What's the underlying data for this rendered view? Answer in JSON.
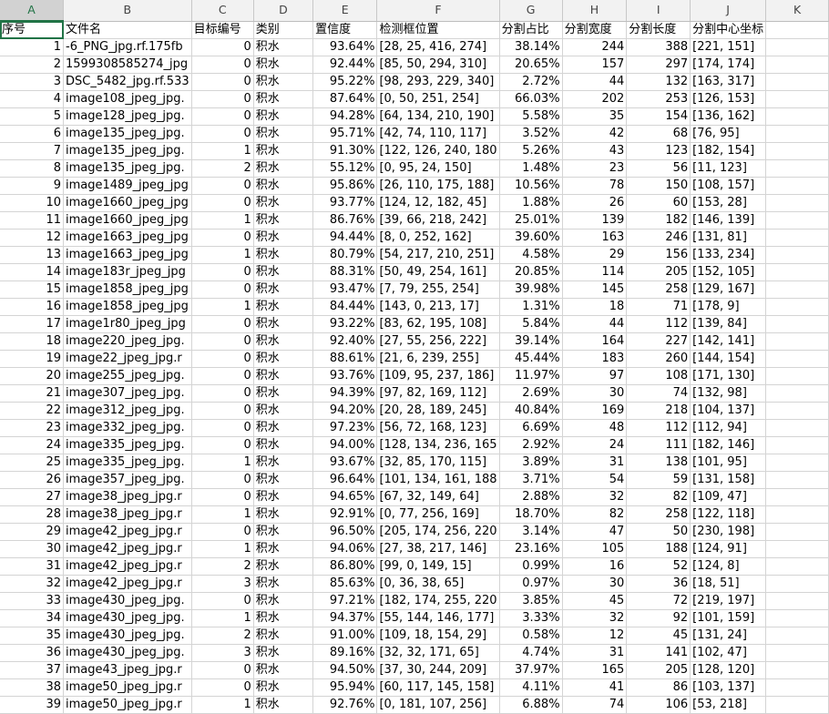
{
  "column_letters": [
    "A",
    "B",
    "C",
    "D",
    "E",
    "F",
    "G",
    "H",
    "I",
    "J",
    "K"
  ],
  "headers": [
    "序号",
    "文件名",
    "目标编号",
    "类别",
    "置信度",
    "检测框位置",
    "分割占比",
    "分割宽度",
    "分割长度",
    "分割中心坐标",
    ""
  ],
  "rows": [
    [
      "1",
      "-6_PNG_jpg.rf.175fb",
      "0",
      "积水",
      "93.64%",
      "[28, 25, 416, 274]",
      "38.14%",
      "244",
      "388",
      "[221, 151]"
    ],
    [
      "2",
      "1599308585274_jpg",
      "0",
      "积水",
      "92.44%",
      "[85, 50, 294, 310]",
      "20.65%",
      "157",
      "297",
      "[174, 174]"
    ],
    [
      "3",
      "DSC_5482_jpg.rf.533",
      "0",
      "积水",
      "95.22%",
      "[98, 293, 229, 340]",
      "2.72%",
      "44",
      "132",
      "[163, 317]"
    ],
    [
      "4",
      "image108_jpeg_jpg.",
      "0",
      "积水",
      "87.64%",
      "[0, 50, 251, 254]",
      "66.03%",
      "202",
      "253",
      "[126, 153]"
    ],
    [
      "5",
      "image128_jpeg_jpg.",
      "0",
      "积水",
      "94.28%",
      "[64, 134, 210, 190]",
      "5.58%",
      "35",
      "154",
      "[136, 162]"
    ],
    [
      "6",
      "image135_jpeg_jpg.",
      "0",
      "积水",
      "95.71%",
      "[42, 74, 110, 117]",
      "3.52%",
      "42",
      "68",
      "[76, 95]"
    ],
    [
      "7",
      "image135_jpeg_jpg.",
      "1",
      "积水",
      "91.30%",
      "[122, 126, 240, 180",
      "5.26%",
      "43",
      "123",
      "[182, 154]"
    ],
    [
      "8",
      "image135_jpeg_jpg.",
      "2",
      "积水",
      "55.12%",
      "[0, 95, 24, 150]",
      "1.48%",
      "23",
      "56",
      "[11, 123]"
    ],
    [
      "9",
      "image1489_jpeg_jpg",
      "0",
      "积水",
      "95.86%",
      "[26, 110, 175, 188]",
      "10.56%",
      "78",
      "150",
      "[108, 157]"
    ],
    [
      "10",
      "image1660_jpeg_jpg",
      "0",
      "积水",
      "93.77%",
      "[124, 12, 182, 45]",
      "1.88%",
      "26",
      "60",
      "[153, 28]"
    ],
    [
      "11",
      "image1660_jpeg_jpg",
      "1",
      "积水",
      "86.76%",
      "[39, 66, 218, 242]",
      "25.01%",
      "139",
      "182",
      "[146, 139]"
    ],
    [
      "12",
      "image1663_jpeg_jpg",
      "0",
      "积水",
      "94.44%",
      "[8, 0, 252, 162]",
      "39.60%",
      "163",
      "246",
      "[131, 81]"
    ],
    [
      "13",
      "image1663_jpeg_jpg",
      "1",
      "积水",
      "80.79%",
      "[54, 217, 210, 251]",
      "4.58%",
      "29",
      "156",
      "[133, 234]"
    ],
    [
      "14",
      "image183r_jpeg_jpg",
      "0",
      "积水",
      "88.31%",
      "[50, 49, 254, 161]",
      "20.85%",
      "114",
      "205",
      "[152, 105]"
    ],
    [
      "15",
      "image1858_jpeg_jpg",
      "0",
      "积水",
      "93.47%",
      "[7, 79, 255, 254]",
      "39.98%",
      "145",
      "258",
      "[129, 167]"
    ],
    [
      "16",
      "image1858_jpeg_jpg",
      "1",
      "积水",
      "84.44%",
      "[143, 0, 213, 17]",
      "1.31%",
      "18",
      "71",
      "[178, 9]"
    ],
    [
      "17",
      "image1r80_jpeg_jpg",
      "0",
      "积水",
      "93.22%",
      "[83, 62, 195, 108]",
      "5.84%",
      "44",
      "112",
      "[139, 84]"
    ],
    [
      "18",
      "image220_jpeg_jpg.",
      "0",
      "积水",
      "92.40%",
      "[27, 55, 256, 222]",
      "39.14%",
      "164",
      "227",
      "[142, 141]"
    ],
    [
      "19",
      "image22_jpeg_jpg.r",
      "0",
      "积水",
      "88.61%",
      "[21, 6, 239, 255]",
      "45.44%",
      "183",
      "260",
      "[144, 154]"
    ],
    [
      "20",
      "image255_jpeg_jpg.",
      "0",
      "积水",
      "93.76%",
      "[109, 95, 237, 186]",
      "11.97%",
      "97",
      "108",
      "[171, 130]"
    ],
    [
      "21",
      "image307_jpeg_jpg.",
      "0",
      "积水",
      "94.39%",
      "[97, 82, 169, 112]",
      "2.69%",
      "30",
      "74",
      "[132, 98]"
    ],
    [
      "22",
      "image312_jpeg_jpg.",
      "0",
      "积水",
      "94.20%",
      "[20, 28, 189, 245]",
      "40.84%",
      "169",
      "218",
      "[104, 137]"
    ],
    [
      "23",
      "image332_jpeg_jpg.",
      "0",
      "积水",
      "97.23%",
      "[56, 72, 168, 123]",
      "6.69%",
      "48",
      "112",
      "[112, 94]"
    ],
    [
      "24",
      "image335_jpeg_jpg.",
      "0",
      "积水",
      "94.00%",
      "[128, 134, 236, 165",
      "2.92%",
      "24",
      "111",
      "[182, 146]"
    ],
    [
      "25",
      "image335_jpeg_jpg.",
      "1",
      "积水",
      "93.67%",
      "[32, 85, 170, 115]",
      "3.89%",
      "31",
      "138",
      "[101, 95]"
    ],
    [
      "26",
      "image357_jpeg_jpg.",
      "0",
      "积水",
      "96.64%",
      "[101, 134, 161, 188",
      "3.71%",
      "54",
      "59",
      "[131, 158]"
    ],
    [
      "27",
      "image38_jpeg_jpg.r",
      "0",
      "积水",
      "94.65%",
      "[67, 32, 149, 64]",
      "2.88%",
      "32",
      "82",
      "[109, 47]"
    ],
    [
      "28",
      "image38_jpeg_jpg.r",
      "1",
      "积水",
      "92.91%",
      "[0, 77, 256, 169]",
      "18.70%",
      "82",
      "258",
      "[122, 118]"
    ],
    [
      "29",
      "image42_jpeg_jpg.r",
      "0",
      "积水",
      "96.50%",
      "[205, 174, 256, 220",
      "3.14%",
      "47",
      "50",
      "[230, 198]"
    ],
    [
      "30",
      "image42_jpeg_jpg.r",
      "1",
      "积水",
      "94.06%",
      "[27, 38, 217, 146]",
      "23.16%",
      "105",
      "188",
      "[124, 91]"
    ],
    [
      "31",
      "image42_jpeg_jpg.r",
      "2",
      "积水",
      "86.80%",
      "[99, 0, 149, 15]",
      "0.99%",
      "16",
      "52",
      "[124, 8]"
    ],
    [
      "32",
      "image42_jpeg_jpg.r",
      "3",
      "积水",
      "85.63%",
      "[0, 36, 38, 65]",
      "0.97%",
      "30",
      "36",
      "[18, 51]"
    ],
    [
      "33",
      "image430_jpeg_jpg.",
      "0",
      "积水",
      "97.21%",
      "[182, 174, 255, 220",
      "3.85%",
      "45",
      "72",
      "[219, 197]"
    ],
    [
      "34",
      "image430_jpeg_jpg.",
      "1",
      "积水",
      "94.37%",
      "[55, 144, 146, 177]",
      "3.33%",
      "32",
      "92",
      "[101, 159]"
    ],
    [
      "35",
      "image430_jpeg_jpg.",
      "2",
      "积水",
      "91.00%",
      "[109, 18, 154, 29]",
      "0.58%",
      "12",
      "45",
      "[131, 24]"
    ],
    [
      "36",
      "image430_jpeg_jpg.",
      "3",
      "积水",
      "89.16%",
      "[32, 32, 171, 65]",
      "4.74%",
      "31",
      "141",
      "[102, 47]"
    ],
    [
      "37",
      "image43_jpeg_jpg.r",
      "0",
      "积水",
      "94.50%",
      "[37, 30, 244, 209]",
      "37.97%",
      "165",
      "205",
      "[128, 120]"
    ],
    [
      "38",
      "image50_jpeg_jpg.r",
      "0",
      "积水",
      "95.94%",
      "[60, 117, 145, 158]",
      "4.11%",
      "41",
      "86",
      "[103, 137]"
    ],
    [
      "39",
      "image50_jpeg_jpg.r",
      "1",
      "积水",
      "92.76%",
      "[0, 181, 107, 256]",
      "6.88%",
      "74",
      "106",
      "[53, 218]"
    ]
  ]
}
